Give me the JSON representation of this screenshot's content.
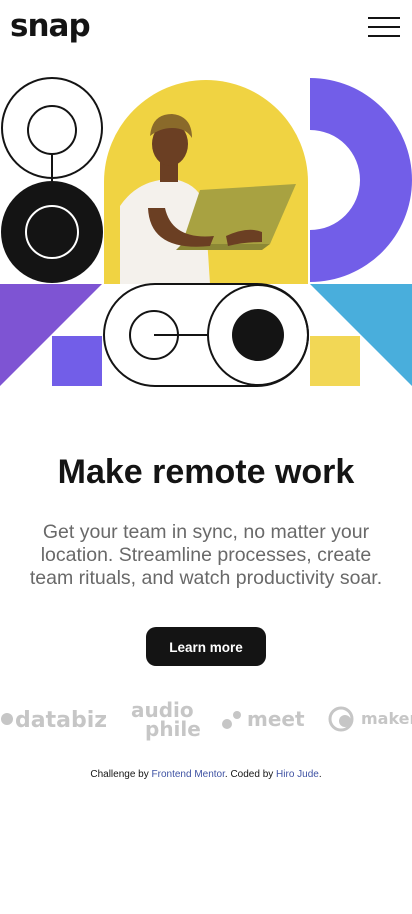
{
  "header": {
    "logo": "snap",
    "menu_icon": "hamburger-menu-icon"
  },
  "hero": {
    "image_description_icon": "hero-illustration",
    "colors": {
      "purple": "#7e54d3",
      "violet": "#725ee8",
      "yellow": "#f2d755",
      "cyan": "#49aedc",
      "dark": "#141414"
    }
  },
  "main": {
    "title": "Make remote work",
    "description": "Get your team in sync, no matter your location. Streamline processes, create team rituals, and watch productivity soar.",
    "cta_label": "Learn more"
  },
  "clients": {
    "logos": [
      "databiz",
      "audiophile",
      "meet",
      "maker"
    ],
    "audiophile_lines": [
      "audio",
      "phile"
    ],
    "color": "#c6c6c6"
  },
  "attribution": {
    "prefix": "Challenge by",
    "mentor_link": "Frontend Mentor",
    "middle": ". Coded by",
    "author_link": "Hiro Jude",
    "suffix": "."
  }
}
